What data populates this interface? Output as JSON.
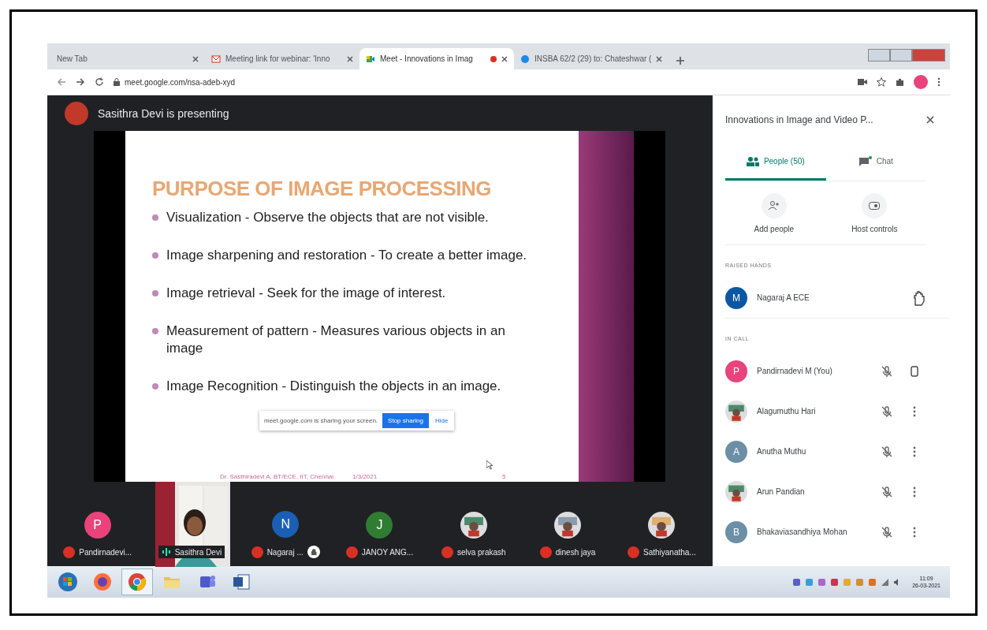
{
  "browser": {
    "tabs": [
      {
        "title": "New Tab",
        "selected": false,
        "kind": "blank"
      },
      {
        "title": "Meeting link for webinar: 'Inno",
        "selected": false,
        "kind": "mail"
      },
      {
        "title": "Meet - Innovations in Imag",
        "selected": true,
        "kind": "meet"
      },
      {
        "title": "INSBA 62/2 (29) to: Chateshwar (",
        "selected": false,
        "kind": "web"
      }
    ],
    "url": "meet.google.com/nsa-adeb-xyd"
  },
  "meet": {
    "presenter": "Sasithra Devi is presenting",
    "slide": {
      "title": "PURPOSE OF IMAGE PROCESSING",
      "bullets": [
        "Visualization - Observe the objects that are not visible.",
        "Image sharpening and restoration - To create a better image.",
        "Image retrieval - Seek for the image of interest.",
        "Measurement of pattern  - Measures various objects in an image",
        "Image Recognition - Distinguish the objects in an image."
      ],
      "footer": "Dr. Sasthiradevi A, BT/ECE, IIT, Chennai",
      "date": "1/3/2021",
      "page": "5"
    },
    "share_bar": {
      "message": "meet.google.com is sharing your screen.",
      "stop": "Stop sharing",
      "hide": "Hide"
    },
    "strip": [
      {
        "name": "Pandirnadevi...",
        "kind": "letter",
        "letter": "P",
        "color": "#e8437a",
        "muted": true
      },
      {
        "name": "Sasithra Devi",
        "kind": "video",
        "muted": false
      },
      {
        "name": "Nagaraj ...",
        "kind": "letter",
        "letter": "N",
        "color": "#1a5fb4",
        "muted": true,
        "hand": true
      },
      {
        "name": "JANOY ANG...",
        "kind": "letter",
        "letter": "J",
        "color": "#2e7d32",
        "muted": true
      },
      {
        "name": "selva prakash",
        "muted": true
      },
      {
        "name": "dinesh jaya",
        "muted": true
      },
      {
        "name": "Sathiyanatha...",
        "muted": true
      }
    ]
  },
  "panel": {
    "title": "Innovations in Image and Video P...",
    "tabs": [
      {
        "label": "People (50)",
        "selected": true,
        "kind": "people"
      },
      {
        "label": "Chat",
        "selected": false,
        "kind": "chat"
      }
    ],
    "actions": [
      {
        "label": "Add people",
        "kind": "add"
      },
      {
        "label": "Host controls",
        "kind": "host"
      }
    ],
    "raised_heading": "RAISED HANDS",
    "raised": [
      {
        "name": "Nagaraj A ECE",
        "kind": "letter",
        "letter": "M",
        "color": "#0b57a4"
      }
    ],
    "in_call_heading": "IN CALL",
    "people": [
      {
        "name": "Pandirnadevi M (You)",
        "kind": "letter",
        "letter": "P",
        "color": "#e8437a",
        "self": true
      },
      {
        "name": "Alagumuthu Hari",
        "self": false
      },
      {
        "name": "Anutha Muthu",
        "kind": "letter",
        "letter": "A",
        "color": "#6c8fa6",
        "self": false
      },
      {
        "name": "Arun Pandian",
        "self": false
      },
      {
        "name": "Bhakaviasandhiya Mohan",
        "kind": "letter",
        "letter": "B",
        "color": "#6c8fa6",
        "self": false
      }
    ]
  },
  "taskbar": {
    "apps": [
      {
        "kind": "start"
      },
      {
        "kind": "firefox"
      },
      {
        "kind": "chrome",
        "selected": true
      },
      {
        "kind": "folder"
      },
      {
        "kind": "teams"
      },
      {
        "kind": "word"
      }
    ],
    "time": "11:09",
    "date": "26-03-2021"
  }
}
